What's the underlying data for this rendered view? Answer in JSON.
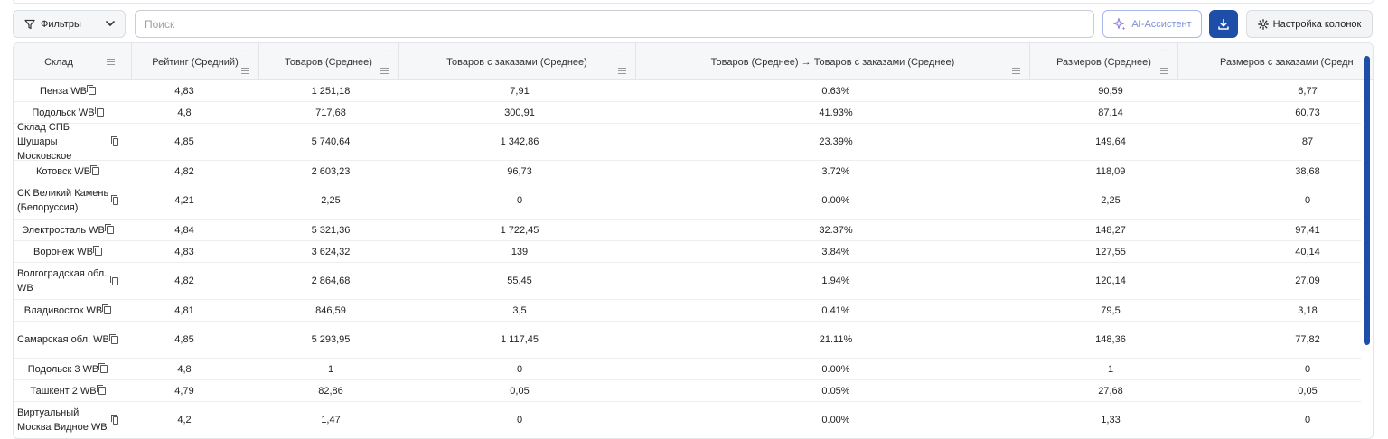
{
  "toolbar": {
    "filters_label": "Фильтры",
    "search_placeholder": "Поиск",
    "ai_label": "AI-Ассистент",
    "columns_label": "Настройка колонок"
  },
  "table": {
    "columns": [
      "Склад",
      "Рейтинг (Средний)",
      "Товаров (Среднее)",
      "Товаров с заказами (Среднее)",
      "Товаров (Среднее) → Товаров с заказами (Среднее)",
      "Размеров (Среднее)",
      "Размеров с заказами (Средн"
    ],
    "rows": [
      [
        "Пенза WB",
        "4,83",
        "1 251,18",
        "7,91",
        "0.63%",
        "90,59",
        "6,77"
      ],
      [
        "Подольск WB",
        "4,8",
        "717,68",
        "300,91",
        "41.93%",
        "87,14",
        "60,73"
      ],
      [
        "Склад СПБ Шушары Московское",
        "4,85",
        "5 740,64",
        "1 342,86",
        "23.39%",
        "149,64",
        "87"
      ],
      [
        "Котовск WB",
        "4,82",
        "2 603,23",
        "96,73",
        "3.72%",
        "118,09",
        "38,68"
      ],
      [
        "СК Великий Камень (Белоруссия)",
        "4,21",
        "2,25",
        "0",
        "0.00%",
        "2,25",
        "0"
      ],
      [
        "Электросталь WB",
        "4,84",
        "5 321,36",
        "1 722,45",
        "32.37%",
        "148,27",
        "97,41"
      ],
      [
        "Воронеж WB",
        "4,83",
        "3 624,32",
        "139",
        "3.84%",
        "127,55",
        "40,14"
      ],
      [
        "Волгоградская обл. WB",
        "4,82",
        "2 864,68",
        "55,45",
        "1.94%",
        "120,14",
        "27,09"
      ],
      [
        "Владивосток WB",
        "4,81",
        "846,59",
        "3,5",
        "0.41%",
        "79,5",
        "3,18"
      ],
      [
        "Самарская обл. WB",
        "4,85",
        "5 293,95",
        "1 117,45",
        "21.11%",
        "148,36",
        "77,82"
      ],
      [
        "Подольск 3 WB",
        "4,8",
        "1",
        "0",
        "0.00%",
        "1",
        "0"
      ],
      [
        "Ташкент 2 WB",
        "4,79",
        "82,86",
        "0,05",
        "0.05%",
        "27,68",
        "0,05"
      ],
      [
        "Виртуальный Москва Видное WB",
        "4,2",
        "1,47",
        "0",
        "0.00%",
        "1,33",
        "0"
      ]
    ]
  },
  "colors": {
    "primary": "#1e4fa8",
    "ai_accent": "#7b8fd8",
    "header_bg": "#f6f7f8",
    "border": "#e3e5e8"
  },
  "icons": [
    "filter-icon",
    "chevron-down-icon",
    "sparkle-icon",
    "download-icon",
    "gear-icon",
    "copy-icon",
    "column-menu-icon"
  ]
}
